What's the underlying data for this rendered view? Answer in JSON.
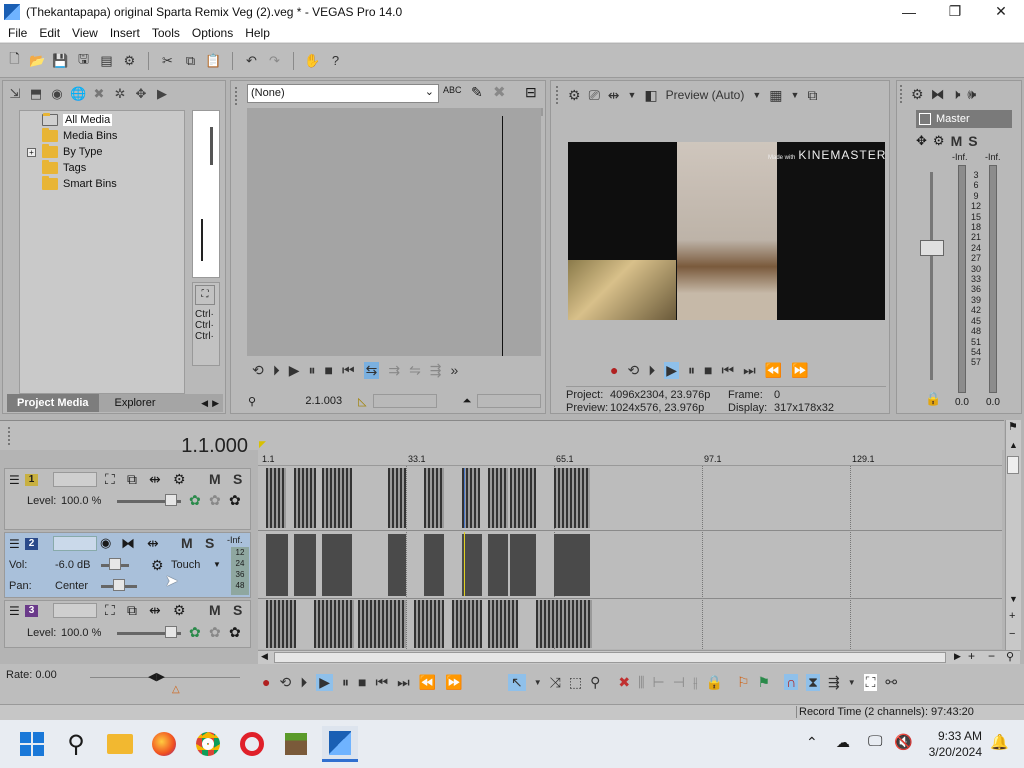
{
  "window": {
    "title": "(Thekantapapa) original Sparta Remix Veg (2).veg * - VEGAS Pro 14.0",
    "min": "—",
    "max": "❐",
    "close": "✕"
  },
  "menu": [
    "File",
    "Edit",
    "View",
    "Insert",
    "Tools",
    "Options",
    "Help"
  ],
  "project_media": {
    "tree": [
      "All Media",
      "Media Bins",
      "By Type",
      "Tags",
      "Smart Bins"
    ],
    "tabs": [
      "Project Media",
      "Explorer"
    ],
    "ctrl": [
      "Ctrl·",
      "Ctrl·",
      "Ctrl·"
    ]
  },
  "trimmer": {
    "selector": "(None)",
    "selector_arrow": "⌄",
    "timecode": "2.1.003"
  },
  "preview": {
    "mode": "Preview (Auto)",
    "watermark_small": "Made with",
    "watermark_brand": "KINEMASTER",
    "project_label": "Project:",
    "project_value": "4096x2304, 23.976p",
    "preview_label": "Preview:",
    "preview_value": "1024x576, 23.976p",
    "frame_label": "Frame:",
    "frame_value": "0",
    "display_label": "Display:",
    "display_value": "317x178x32"
  },
  "mixer": {
    "master": "Master",
    "m": "M",
    "s": "S",
    "inf_left": "-Inf.",
    "inf_right": "-Inf.",
    "scale": [
      "3",
      "6",
      "9",
      "12",
      "15",
      "18",
      "21",
      "24",
      "27",
      "30",
      "33",
      "36",
      "39",
      "42",
      "45",
      "48",
      "51",
      "54",
      "57"
    ],
    "bottom_left": "0.0",
    "bottom_right": "0.0"
  },
  "timeline": {
    "position": "1.1.000",
    "ruler": [
      "1.1",
      "33.1",
      "65.1",
      "97.1",
      "129.1"
    ],
    "rate": "Rate: 0.00",
    "record_time": "Record Time (2 channels): 97:43:20"
  },
  "tracks": [
    {
      "num": "1",
      "level_label": "Level:",
      "level": "100.0 %",
      "m": "M",
      "s": "S"
    },
    {
      "num": "2",
      "vol_label": "Vol:",
      "vol": "-6.0 dB",
      "pan_label": "Pan:",
      "pan": "Center",
      "touch": "Touch",
      "inf": "-Inf.",
      "meter_ticks": [
        "12",
        "24",
        "36",
        "48"
      ],
      "m": "M",
      "s": "S"
    },
    {
      "num": "3",
      "level_label": "Level:",
      "level": "100.0 %",
      "m": "M",
      "s": "S"
    }
  ],
  "taskbar": {
    "time": "9:33 AM",
    "date": "3/20/2024"
  },
  "colors": {
    "track1": "#c8b040",
    "track2": "#2b4a8a",
    "track3": "#6a3a8a",
    "selected_track": "#a9c0da"
  }
}
